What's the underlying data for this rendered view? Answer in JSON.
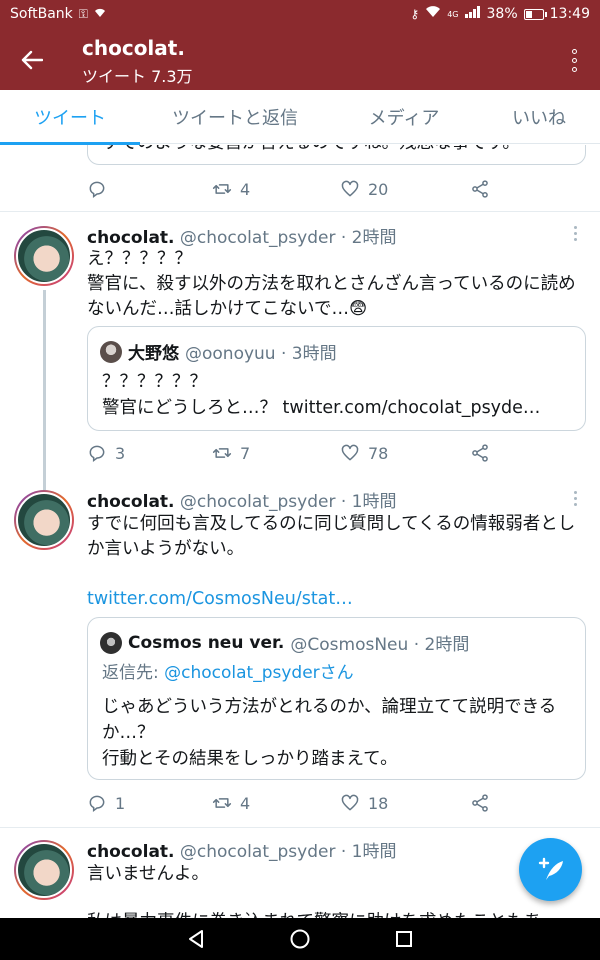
{
  "status_bar": {
    "carrier": "SoftBank",
    "network": "4G",
    "battery": "38%",
    "battery_level": 0.38,
    "time": "13:49"
  },
  "app_bar": {
    "title": "chocolat.",
    "subtitle": "ツイート 7.3万"
  },
  "tabs": [
    {
      "label": "ツイート",
      "active": true
    },
    {
      "label": "ツイートと返信",
      "active": false
    },
    {
      "label": "メディア",
      "active": false
    },
    {
      "label": "いいね",
      "active": false
    }
  ],
  "top_partial": {
    "text": "すでのような要旨が言えるのですね。残念な事です。",
    "replies": "",
    "retweets": "4",
    "likes": "20"
  },
  "tweets": [
    {
      "name": "chocolat.",
      "meta": "@chocolat_psyder · 2時間",
      "text": "え？？？？？\n警官に、殺す以外の方法を取れとさんざん言っているのに読めないんだ…話しかけてこないで…😨",
      "quote": {
        "name": "大野悠",
        "meta": "@oonoyuu · 3時間",
        "text": "？？？？？？\n警官にどうしろと…？ twitter.com/chocolat_psyde…"
      },
      "replies": "3",
      "retweets": "7",
      "likes": "78"
    },
    {
      "name": "chocolat.",
      "meta": "@chocolat_psyder · 1時間",
      "text": "すでに何回も言及してるのに同じ質問してくるの情報弱者としか言いようがない。",
      "link": "twitter.com/CosmosNeu/stat…",
      "quote": {
        "name": "Cosmos neu ver.",
        "meta": "@CosmosNeu · 2時間",
        "reply_prefix": "返信先: ",
        "reply_to": "@chocolat_psyderさん",
        "text": "じゃあどういう方法がとれるのか、論理立てて説明できるか…？\n行動とその結果をしっかり踏まえて。"
      },
      "replies": "1",
      "retweets": "4",
      "likes": "18"
    },
    {
      "name": "chocolat.",
      "meta": "@chocolat_psyder · 1時間",
      "text": "言いませんよ。",
      "text_partial": "私は暴力事件に巻き込まれて警察に助けを求めたこともあ"
    }
  ],
  "icons": {
    "back": "arrow-left-icon",
    "more": "more-vertical-icon",
    "reply": "reply-icon",
    "retweet": "retweet-icon",
    "like": "heart-icon",
    "share": "share-icon",
    "compose": "compose-tweet-icon"
  },
  "colors": {
    "app_bar": "#8b2a2e",
    "accent": "#1da1f2",
    "link": "#1b95e0",
    "muted": "#657786"
  }
}
